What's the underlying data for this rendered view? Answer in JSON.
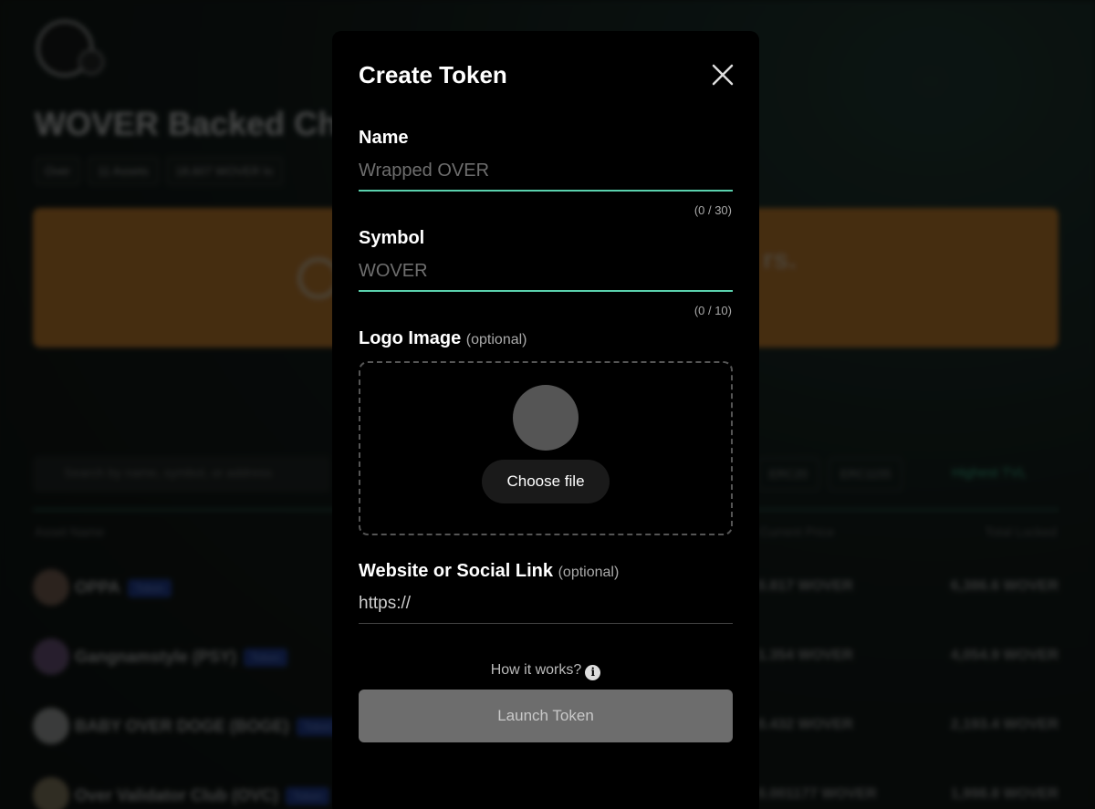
{
  "background": {
    "page_title": "WOVER Backed Chi",
    "pills": [
      "Over",
      "11 Assets",
      "18,607 WOVER lo"
    ],
    "banner_text": "rs.",
    "search_placeholder": "Search by name, symbol, or address",
    "filters": [
      "ERC20",
      "ERC1155"
    ],
    "sort_label": "Highest TVL",
    "columns": {
      "asset_name": "Asset Name",
      "current_price": "Current Price",
      "total_locked": "Total Locked"
    },
    "rows": [
      {
        "name": "OPPA",
        "tag": "Token",
        "price": "0.817 WOVER",
        "total": "6,386.6 WOVER"
      },
      {
        "name": "Gangnamstyle (PSY)",
        "tag": "Token",
        "price": "1.354 WOVER",
        "total": "4,054.9 WOVER"
      },
      {
        "name": "BABY OVER DOGE (BOGE)",
        "tag": "Token",
        "price": "0.432 WOVER",
        "total": "2,193.4 WOVER"
      },
      {
        "name": "Over Validator Club (OVC)",
        "tag": "Token",
        "price": "0.001177 WOVER",
        "total": "1,998.8 WOVER"
      }
    ]
  },
  "modal": {
    "title": "Create Token",
    "name_field": {
      "label": "Name",
      "placeholder": "Wrapped OVER",
      "counter": "(0 / 30)"
    },
    "symbol_field": {
      "label": "Symbol",
      "placeholder": "WOVER",
      "counter": "(0 / 10)"
    },
    "logo_field": {
      "label": "Logo Image",
      "optional": "(optional)",
      "button": "Choose file"
    },
    "link_field": {
      "label": "Website or Social Link",
      "optional": "(optional)",
      "value": "https://"
    },
    "how_it_works": "How it works?",
    "info_glyph": "i",
    "launch_button": "Launch Token"
  },
  "colors": {
    "accent": "#5ad1ad",
    "banner": "#e08a2c",
    "launch_disabled": "#6d6d6d"
  }
}
